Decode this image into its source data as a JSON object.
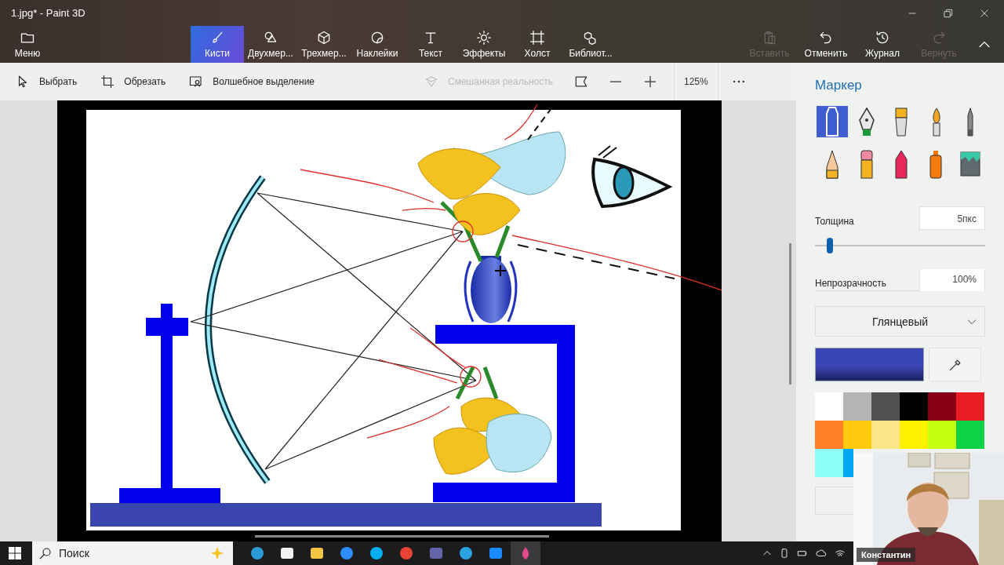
{
  "window": {
    "title": "1.jpg* - Paint 3D"
  },
  "ribbon": {
    "menu": {
      "label": "Меню"
    },
    "tabs": [
      {
        "kind": "brushes",
        "label": "Кисти",
        "selected": true
      },
      {
        "kind": "shapes2d",
        "label": "Двухмер...",
        "selected": false
      },
      {
        "kind": "shapes3d",
        "label": "Трехмер...",
        "selected": false
      },
      {
        "kind": "stickers",
        "label": "Наклейки",
        "selected": false
      },
      {
        "kind": "text",
        "label": "Текст",
        "selected": false
      },
      {
        "kind": "effects",
        "label": "Эффекты",
        "selected": false
      },
      {
        "kind": "canvas",
        "label": "Холст",
        "selected": false
      },
      {
        "kind": "library",
        "label": "Библиот...",
        "selected": false
      }
    ],
    "actions": [
      {
        "kind": "paste",
        "label": "Вставить",
        "disabled": true
      },
      {
        "kind": "undo",
        "label": "Отменить",
        "disabled": false
      },
      {
        "kind": "history",
        "label": "Журнал",
        "disabled": false
      },
      {
        "kind": "redo",
        "label": "Вернуть",
        "disabled": true
      }
    ]
  },
  "toolbar": {
    "tools": [
      {
        "kind": "select",
        "label": "Выбрать",
        "disabled": false
      },
      {
        "kind": "crop",
        "label": "Обрезать",
        "disabled": false
      },
      {
        "kind": "magic",
        "label": "Волшебное выделение",
        "disabled": false
      },
      {
        "kind": "mixed",
        "label": "Смешанная реальность",
        "disabled": true
      }
    ],
    "zoom": "125%"
  },
  "panel": {
    "title": "Маркер",
    "brushes": [
      {
        "kind": "marker",
        "selected": true
      },
      {
        "kind": "pen",
        "selected": false
      },
      {
        "kind": "oil",
        "selected": false
      },
      {
        "kind": "watercolor",
        "selected": false
      },
      {
        "kind": "pixel",
        "selected": false
      },
      {
        "kind": "pencil",
        "selected": false
      },
      {
        "kind": "eraser",
        "selected": false
      },
      {
        "kind": "crayon",
        "selected": false
      },
      {
        "kind": "spray",
        "selected": false
      },
      {
        "kind": "fill",
        "selected": false
      }
    ],
    "thickness": {
      "label": "Толщина",
      "value": "5пкс",
      "level": 0.03
    },
    "opacity": {
      "label": "Непрозрачность",
      "value": "100%"
    },
    "finish": "Глянцевый",
    "current": {
      "color": "#3a45b5"
    },
    "palette": [
      {
        "color": "#ffffff"
      },
      {
        "color": "#b4b6b4"
      },
      {
        "color": "#4f524f"
      },
      {
        "color": "#000000"
      },
      {
        "color": "#880015"
      },
      {
        "color": "#ec1c24"
      },
      {
        "color": "#ff7f27"
      },
      {
        "color": "#ffc90e"
      },
      {
        "color": "#fde68a"
      },
      {
        "color": "#fff200"
      },
      {
        "color": "#c4ff0e"
      },
      {
        "color": "#0ed145"
      },
      {
        "color": "#8cfffb"
      },
      {
        "color": "#00a8f3"
      }
    ]
  },
  "taskbar": {
    "search": {
      "placeholder": "Поиск"
    }
  },
  "video": {
    "caption": "Константин"
  }
}
